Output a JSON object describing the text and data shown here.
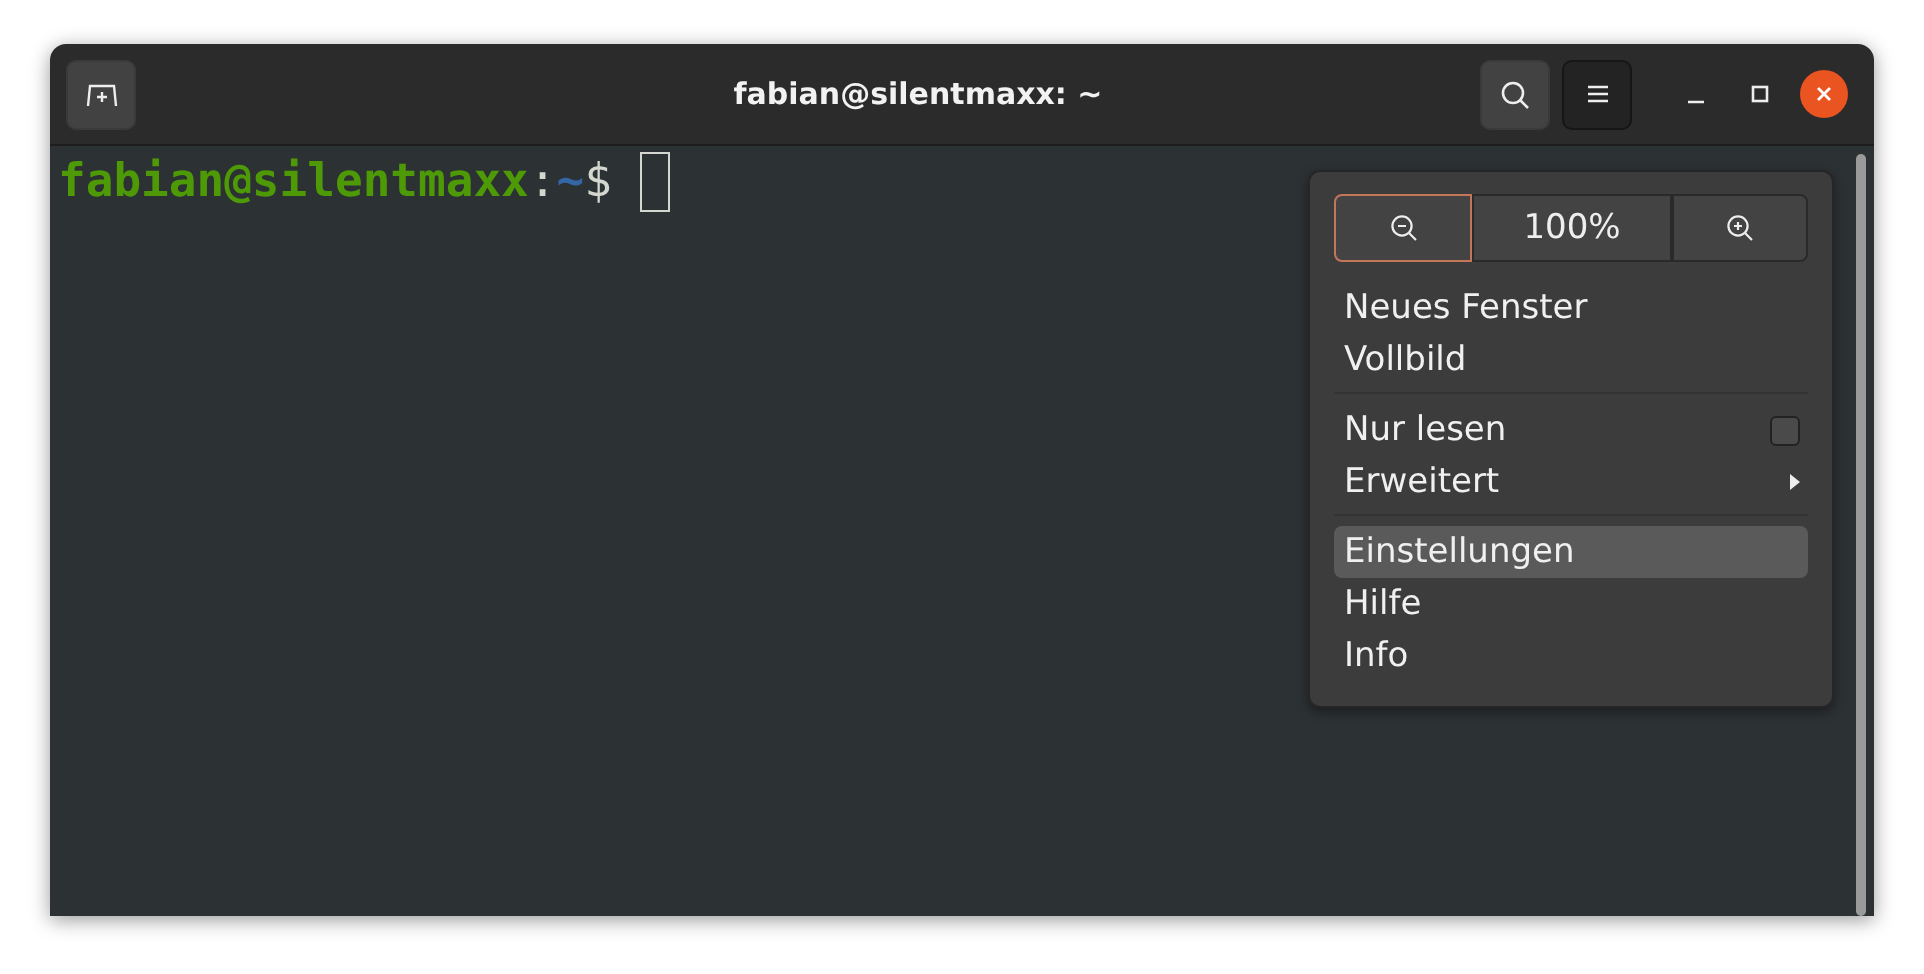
{
  "window": {
    "title": "fabian@silentmaxx: ~"
  },
  "header_buttons": [
    {
      "kind": "search",
      "pressed": false
    },
    {
      "kind": "menu",
      "pressed": true
    }
  ],
  "terminal": {
    "user_host": "fabian@silentmaxx",
    "separator": ":",
    "path": "~",
    "prompt": "$"
  },
  "menu": {
    "zoom": [
      {
        "kind": "zoom-out",
        "focused": true
      },
      {
        "kind": "level",
        "text": "100%",
        "focused": false
      },
      {
        "kind": "zoom-in",
        "focused": false
      }
    ],
    "sections": [
      [
        {
          "kind": "item",
          "label": "Neues Fenster",
          "selected": false
        },
        {
          "kind": "item",
          "label": "Vollbild",
          "selected": false
        }
      ],
      [
        {
          "kind": "checkbox",
          "label": "Nur lesen",
          "checked": false,
          "selected": false
        },
        {
          "kind": "submenu",
          "label": "Erweitert",
          "selected": false
        }
      ],
      [
        {
          "kind": "item",
          "label": "Einstellungen",
          "selected": true
        },
        {
          "kind": "item",
          "label": "Hilfe",
          "selected": false
        },
        {
          "kind": "item",
          "label": "Info",
          "selected": false
        }
      ]
    ]
  }
}
